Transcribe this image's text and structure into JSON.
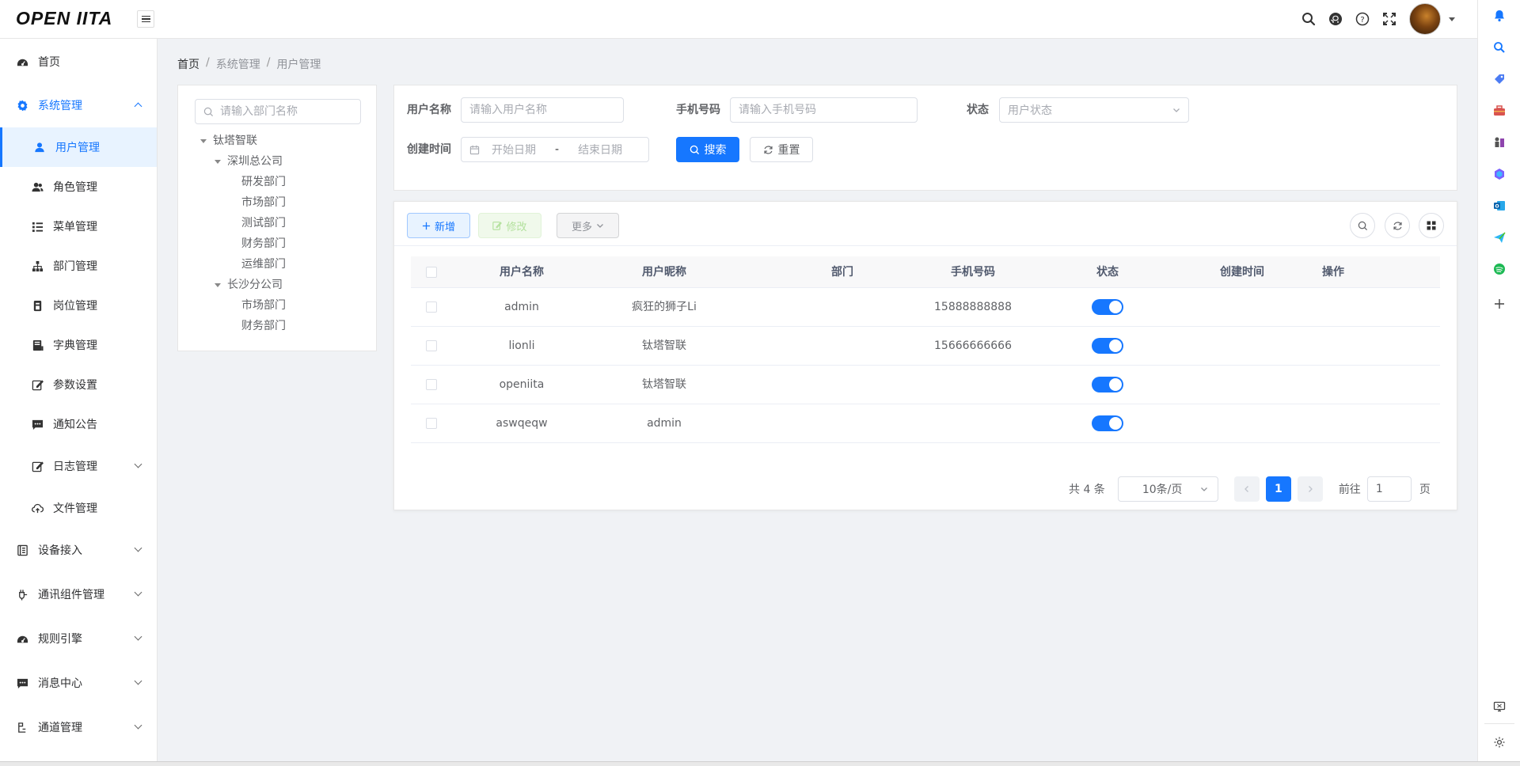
{
  "app": {
    "logo": "OPEN IITA"
  },
  "colors": {
    "accent": "#1677ff",
    "active_bg": "#e8f3ff"
  },
  "sidebar": {
    "items": [
      {
        "label": "首页",
        "icon": "dashboard-icon"
      },
      {
        "label": "系统管理",
        "icon": "gear-icon",
        "expanded": true
      },
      {
        "label": "用户管理",
        "icon": "user-icon",
        "active": true
      },
      {
        "label": "角色管理",
        "icon": "users-icon"
      },
      {
        "label": "菜单管理",
        "icon": "list-icon"
      },
      {
        "label": "部门管理",
        "icon": "org-tree-icon"
      },
      {
        "label": "岗位管理",
        "icon": "post-icon"
      },
      {
        "label": "字典管理",
        "icon": "book-icon"
      },
      {
        "label": "参数设置",
        "icon": "edit-icon"
      },
      {
        "label": "通知公告",
        "icon": "message-icon"
      },
      {
        "label": "日志管理",
        "icon": "log-icon"
      },
      {
        "label": "文件管理",
        "icon": "cloud-upload-icon"
      },
      {
        "label": "设备接入",
        "icon": "device-icon"
      },
      {
        "label": "通讯组件管理",
        "icon": "plug-icon"
      },
      {
        "label": "规则引擎",
        "icon": "dashboard-icon"
      },
      {
        "label": "消息中心",
        "icon": "message-icon"
      },
      {
        "label": "通道管理",
        "icon": "channel-icon"
      }
    ]
  },
  "breadcrumb": {
    "home": "首页",
    "sep": "/",
    "level1": "系统管理",
    "level2": "用户管理"
  },
  "dept_tree": {
    "search_placeholder": "请输入部门名称",
    "nodes": [
      {
        "label": "钛塔智联",
        "level": 0,
        "expanded": true
      },
      {
        "label": "深圳总公司",
        "level": 1,
        "expanded": true
      },
      {
        "label": "研发部门",
        "level": 2
      },
      {
        "label": "市场部门",
        "level": 2
      },
      {
        "label": "测试部门",
        "level": 2
      },
      {
        "label": "财务部门",
        "level": 2
      },
      {
        "label": "运维部门",
        "level": 2
      },
      {
        "label": "长沙分公司",
        "level": 1,
        "expanded": true
      },
      {
        "label": "市场部门",
        "level": 2
      },
      {
        "label": "财务部门",
        "level": 2
      }
    ]
  },
  "search_form": {
    "username_label": "用户名称",
    "username_placeholder": "请输入用户名称",
    "phone_label": "手机号码",
    "phone_placeholder": "请输入手机号码",
    "status_label": "状态",
    "status_placeholder": "用户状态",
    "created_label": "创建时间",
    "start_placeholder": "开始日期",
    "range_sep": "-",
    "end_placeholder": "结束日期",
    "search_btn": "搜索",
    "reset_btn": "重置"
  },
  "toolbar": {
    "add": "新增",
    "edit": "修改",
    "more": "更多"
  },
  "table": {
    "columns": [
      "用户名称",
      "用户昵称",
      "部门",
      "手机号码",
      "状态",
      "创建时间",
      "操作"
    ],
    "rows": [
      {
        "username": "admin",
        "nickname": "疯狂的狮子Li",
        "dept": "",
        "phone": "15888888888",
        "enabled": true,
        "created": "",
        "ops": ""
      },
      {
        "username": "lionli",
        "nickname": "钛塔智联",
        "dept": "",
        "phone": "15666666666",
        "enabled": true,
        "created": "",
        "ops": ""
      },
      {
        "username": "openiita",
        "nickname": "钛塔智联",
        "dept": "",
        "phone": "",
        "enabled": true,
        "created": "",
        "ops": ""
      },
      {
        "username": "aswqeqw",
        "nickname": "admin",
        "dept": "",
        "phone": "",
        "enabled": true,
        "created": "",
        "ops": ""
      }
    ]
  },
  "pagination": {
    "total_text": "共 4 条",
    "page_size": "10条/页",
    "current_page": "1",
    "goto_label": "前往",
    "goto_value": "1",
    "page_suffix": "页"
  }
}
